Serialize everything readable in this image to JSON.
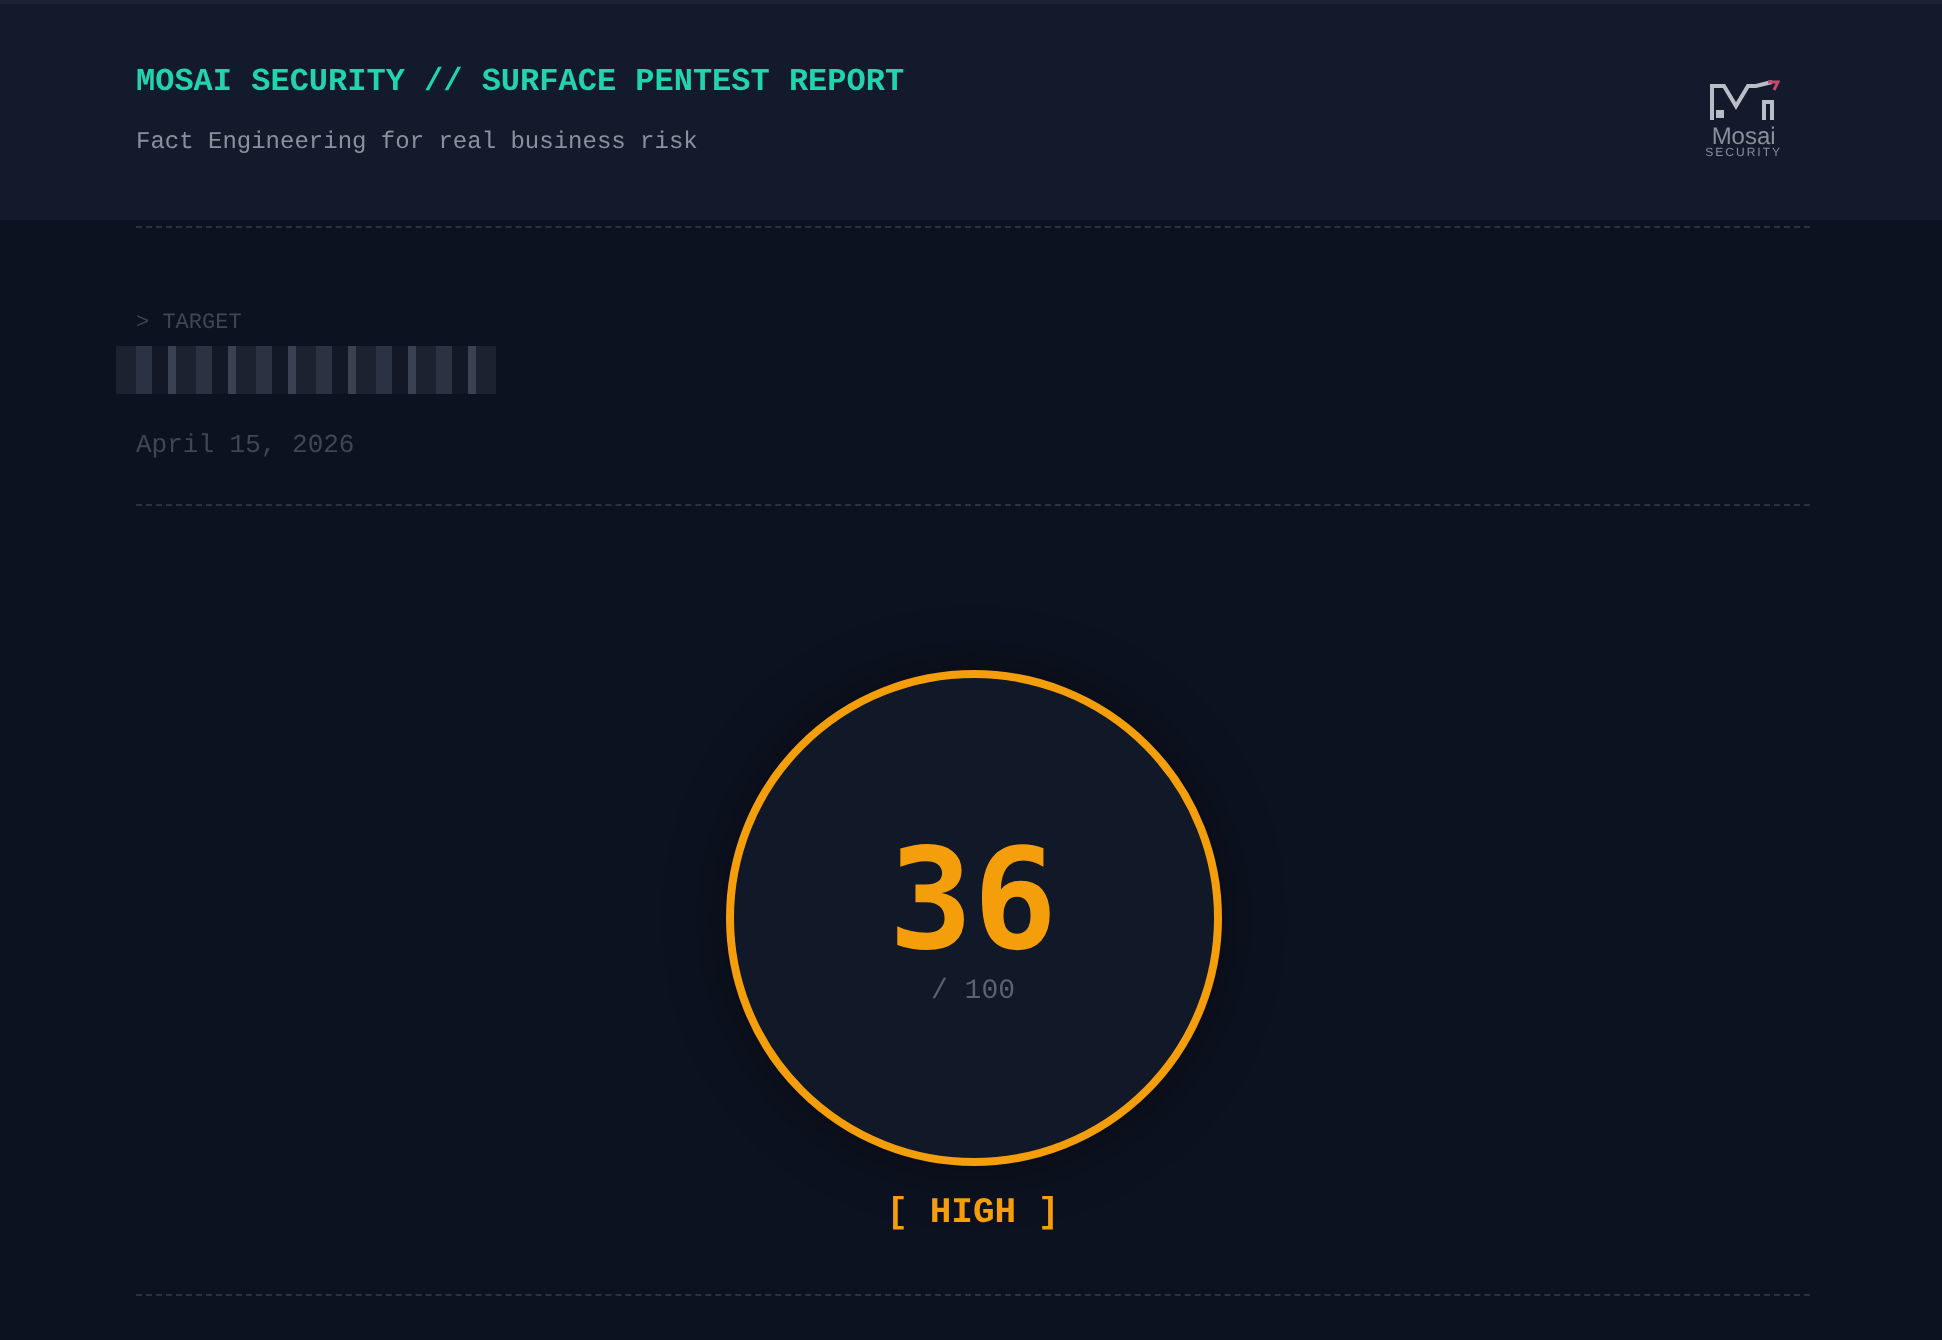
{
  "header": {
    "title": "MOSAI SECURITY // SURFACE PENTEST REPORT",
    "subtitle": "Fact Engineering for real business risk",
    "logo": {
      "name": "Mosai",
      "tagline": "SECURITY"
    }
  },
  "target": {
    "label": "> TARGET",
    "redacted": true,
    "date": "April 15, 2026"
  },
  "score": {
    "value": "36",
    "max": "/ 100",
    "rating": "[ HIGH ]",
    "kind": "high"
  }
}
